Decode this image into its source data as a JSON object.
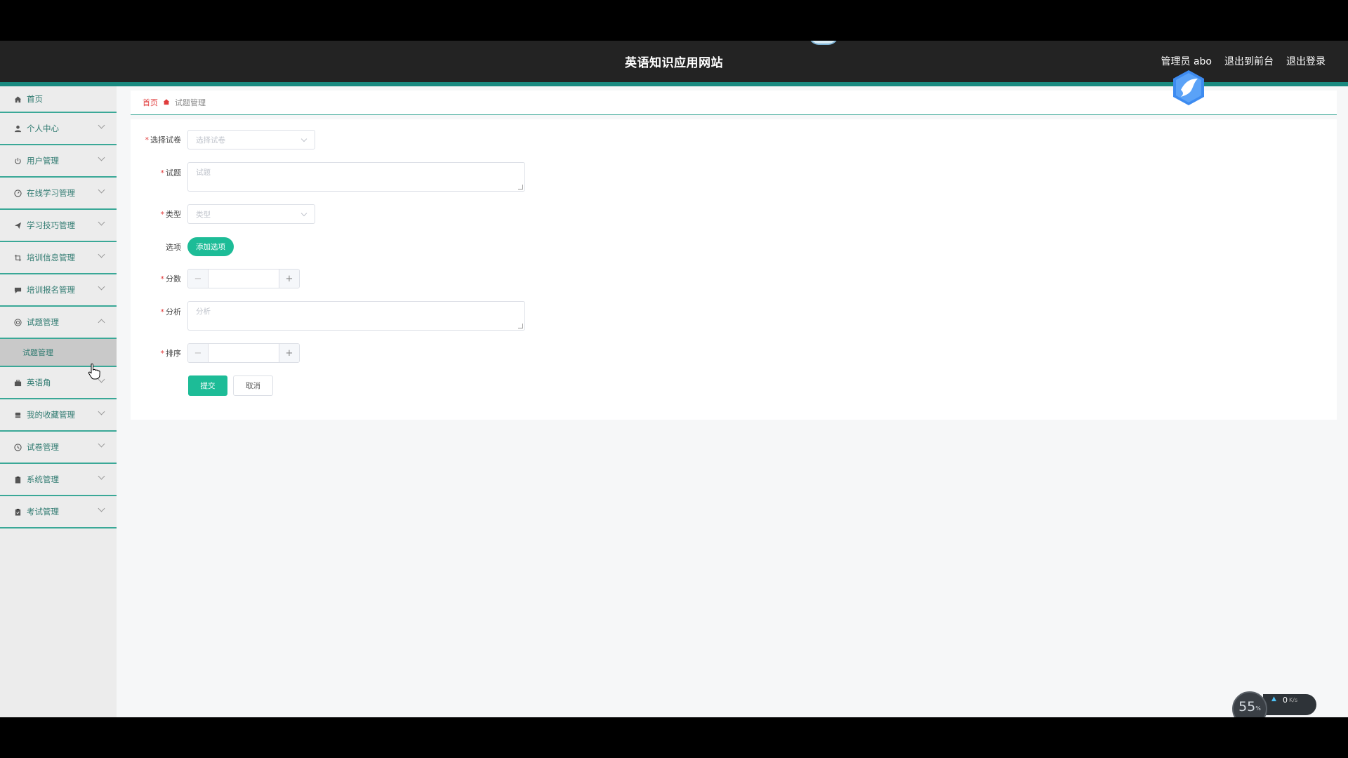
{
  "header": {
    "site_title": "英语知识应用网站",
    "user_label": "管理员 abo",
    "back_to_front": "退出到前台",
    "logout": "退出登录"
  },
  "sidebar": {
    "items": [
      {
        "label": "首页",
        "icon": "home-icon"
      },
      {
        "label": "个人中心",
        "icon": "user-icon"
      },
      {
        "label": "用户管理",
        "icon": "power-icon"
      },
      {
        "label": "在线学习管理",
        "icon": "gauge-icon"
      },
      {
        "label": "学习技巧管理",
        "icon": "send-icon"
      },
      {
        "label": "培训信息管理",
        "icon": "crop-icon"
      },
      {
        "label": "培训报名管理",
        "icon": "chat-icon"
      },
      {
        "label": "试题管理",
        "icon": "target-icon"
      },
      {
        "label": "英语角",
        "icon": "briefcase-icon"
      },
      {
        "label": "我的收藏管理",
        "icon": "stack-icon"
      },
      {
        "label": "试卷管理",
        "icon": "clock-icon"
      },
      {
        "label": "系统管理",
        "icon": "clipboard-icon"
      },
      {
        "label": "考试管理",
        "icon": "clipboard-check-icon"
      }
    ],
    "submenu": {
      "label": "试题管理"
    }
  },
  "breadcrumb": {
    "home": "首页",
    "current": "试题管理"
  },
  "form": {
    "paper": {
      "label": "选择试卷",
      "placeholder": "选择试卷"
    },
    "question": {
      "label": "试题",
      "placeholder": "试题"
    },
    "type": {
      "label": "类型",
      "placeholder": "类型"
    },
    "options": {
      "label": "选项",
      "add_button": "添加选项"
    },
    "score": {
      "label": "分数",
      "value": ""
    },
    "analysis": {
      "label": "分析",
      "placeholder": "分析"
    },
    "order": {
      "label": "排序",
      "value": ""
    },
    "submit": "提交",
    "cancel": "取消"
  },
  "speed_widget": {
    "percent": "55",
    "percent_unit": "%",
    "rate": "0",
    "rate_unit": "K/s"
  },
  "colors": {
    "accent": "#1dbc97",
    "sidebar_border": "#3aa897",
    "required": "#e03c3c",
    "header_bg": "#232323"
  }
}
